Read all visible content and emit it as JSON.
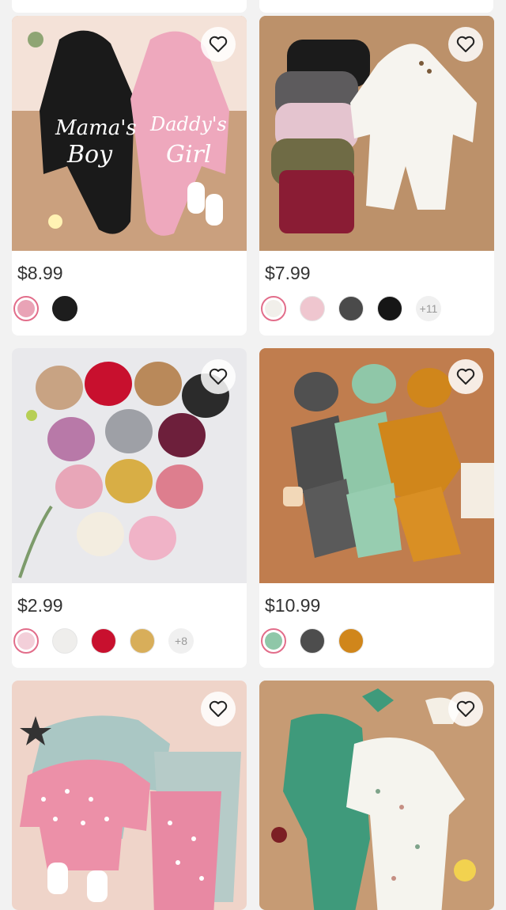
{
  "products": [
    {
      "id": "p1",
      "price": "$8.99",
      "swatches": [
        "#e9a3b6",
        "#1d1d1d"
      ],
      "more": ""
    },
    {
      "id": "p2",
      "price": "$7.99",
      "swatches": [
        "#f1efea",
        "#efc6cf",
        "#4a4a4a",
        "#161616"
      ],
      "more": "+11"
    },
    {
      "id": "p3",
      "price": "$2.99",
      "swatches": [
        "#f3cfd9",
        "#efeeec",
        "#c8102e",
        "#d8ae5a"
      ],
      "more": "+8"
    },
    {
      "id": "p4",
      "price": "$10.99",
      "swatches": [
        "#8fc7a8",
        "#4d4d4d",
        "#d0861b"
      ],
      "more": ""
    },
    {
      "id": "p5"
    },
    {
      "id": "p6"
    }
  ],
  "colors": {
    "selected_ring": "#e26d8a",
    "price_text": "#333333",
    "page_background": "#f2f2f2"
  }
}
